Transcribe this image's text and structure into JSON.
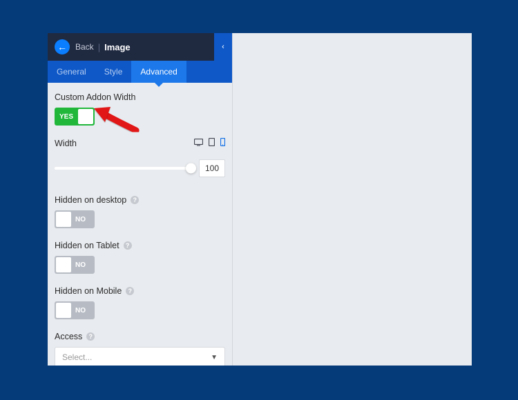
{
  "header": {
    "back_label": "Back",
    "title": "Image"
  },
  "tabs": {
    "general": "General",
    "style": "Style",
    "advanced": "Advanced"
  },
  "fields": {
    "custom_width_label": "Custom Addon Width",
    "custom_width_toggle": "YES",
    "width_label": "Width",
    "width_value": "100",
    "hidden_desktop_label": "Hidden on desktop",
    "hidden_desktop_toggle": "NO",
    "hidden_tablet_label": "Hidden on Tablet",
    "hidden_tablet_toggle": "NO",
    "hidden_mobile_label": "Hidden on Mobile",
    "hidden_mobile_toggle": "NO",
    "access_label": "Access",
    "access_placeholder": "Select..."
  }
}
